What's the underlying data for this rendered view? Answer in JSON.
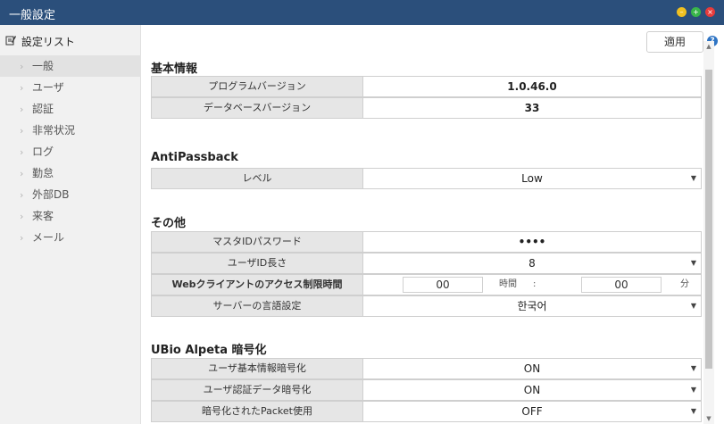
{
  "window": {
    "title": "一般設定"
  },
  "sidebar": {
    "title": "設定リスト",
    "items": [
      {
        "label": "一般",
        "active": true
      },
      {
        "label": "ユーザ"
      },
      {
        "label": "認証"
      },
      {
        "label": "非常状況"
      },
      {
        "label": "ログ"
      },
      {
        "label": "勤怠"
      },
      {
        "label": "外部DB"
      },
      {
        "label": "来客"
      },
      {
        "label": "メール"
      }
    ]
  },
  "toolbar": {
    "apply_label": "適用",
    "help": "?"
  },
  "sections": {
    "basic": {
      "title": "基本情報",
      "rows": [
        {
          "label": "プログラムバージョン",
          "value": "1.0.46.0"
        },
        {
          "label": "データベースバージョン",
          "value": "33"
        }
      ]
    },
    "antipassback": {
      "title": "AntiPassback",
      "rows": [
        {
          "label": "レベル",
          "value": "Low"
        }
      ]
    },
    "other": {
      "title": "その他",
      "rows": [
        {
          "label": "マスタIDパスワード",
          "value": "••••"
        },
        {
          "label": "ユーザID長さ",
          "value": "8"
        },
        {
          "label": "Webクライアントのアクセス制限時間",
          "hours": "00",
          "hours_unit": "時間",
          "separator": ":",
          "minutes": "00",
          "minutes_unit": "分"
        },
        {
          "label": "サーバーの言語設定",
          "value": "한국어"
        }
      ]
    },
    "encryption": {
      "title": "UBio Alpeta 暗号化",
      "rows": [
        {
          "label": "ユーザ基本情報暗号化",
          "value": "ON"
        },
        {
          "label": "ユーザ認証データ暗号化",
          "value": "ON"
        },
        {
          "label": "暗号化されたPacket使用",
          "value": "OFF"
        }
      ]
    }
  }
}
